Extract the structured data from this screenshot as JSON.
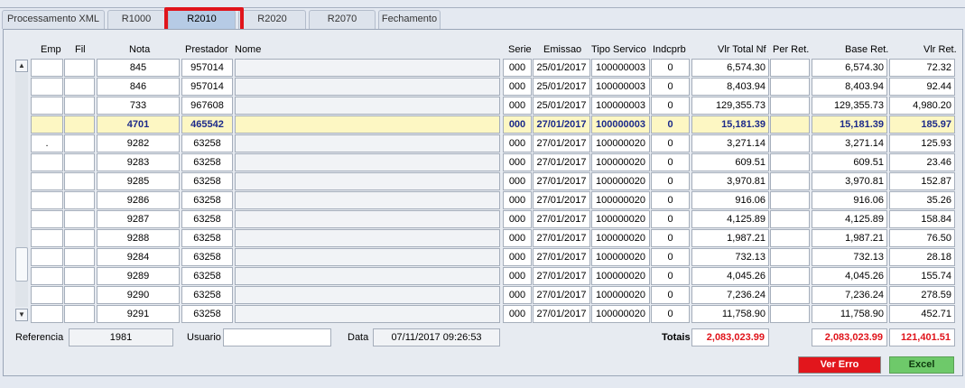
{
  "tabs": [
    {
      "label": "Processamento XML",
      "active": false
    },
    {
      "label": "R1000",
      "active": false
    },
    {
      "label": "R2010",
      "active": true
    },
    {
      "label": "R2020",
      "active": false
    },
    {
      "label": "R2070",
      "active": false
    },
    {
      "label": "Fechamento",
      "active": false
    }
  ],
  "columns": {
    "emp": "Emp",
    "fil": "Fil",
    "nota": "Nota",
    "prestador": "Prestador",
    "nome": "Nome",
    "serie": "Serie",
    "emissao": "Emissao",
    "tipo_servico": "Tipo Servico",
    "indcprb": "Indcprb",
    "vlr_total_nf": "Vlr Total Nf",
    "per_ret": "Per Ret.",
    "base_ret": "Base Ret.",
    "vlr_ret": "Vlr Ret."
  },
  "rows": [
    {
      "emp": "",
      "nota": "845",
      "prestador": "957014",
      "serie": "000",
      "emissao": "25/01/2017",
      "tipo_servico": "100000003",
      "indcprb": "0",
      "vlr_total_nf": "6,574.30",
      "base_ret": "6,574.30",
      "vlr_ret": "72.32"
    },
    {
      "emp": "",
      "nota": "846",
      "prestador": "957014",
      "serie": "000",
      "emissao": "25/01/2017",
      "tipo_servico": "100000003",
      "indcprb": "0",
      "vlr_total_nf": "8,403.94",
      "base_ret": "8,403.94",
      "vlr_ret": "92.44"
    },
    {
      "emp": "",
      "nota": "733",
      "prestador": "967608",
      "serie": "000",
      "emissao": "25/01/2017",
      "tipo_servico": "100000003",
      "indcprb": "0",
      "vlr_total_nf": "129,355.73",
      "base_ret": "129,355.73",
      "vlr_ret": "4,980.20"
    },
    {
      "emp": "",
      "nota": "4701",
      "prestador": "465542",
      "serie": "000",
      "emissao": "27/01/2017",
      "tipo_servico": "100000003",
      "indcprb": "0",
      "vlr_total_nf": "15,181.39",
      "base_ret": "15,181.39",
      "vlr_ret": "185.97",
      "selected": true
    },
    {
      "emp": ".",
      "nota": "9282",
      "prestador": "63258",
      "serie": "000",
      "emissao": "27/01/2017",
      "tipo_servico": "100000020",
      "indcprb": "0",
      "vlr_total_nf": "3,271.14",
      "base_ret": "3,271.14",
      "vlr_ret": "125.93"
    },
    {
      "emp": "",
      "nota": "9283",
      "prestador": "63258",
      "serie": "000",
      "emissao": "27/01/2017",
      "tipo_servico": "100000020",
      "indcprb": "0",
      "vlr_total_nf": "609.51",
      "base_ret": "609.51",
      "vlr_ret": "23.46"
    },
    {
      "emp": "",
      "nota": "9285",
      "prestador": "63258",
      "serie": "000",
      "emissao": "27/01/2017",
      "tipo_servico": "100000020",
      "indcprb": "0",
      "vlr_total_nf": "3,970.81",
      "base_ret": "3,970.81",
      "vlr_ret": "152.87"
    },
    {
      "emp": "",
      "nota": "9286",
      "prestador": "63258",
      "serie": "000",
      "emissao": "27/01/2017",
      "tipo_servico": "100000020",
      "indcprb": "0",
      "vlr_total_nf": "916.06",
      "base_ret": "916.06",
      "vlr_ret": "35.26"
    },
    {
      "emp": "",
      "nota": "9287",
      "prestador": "63258",
      "serie": "000",
      "emissao": "27/01/2017",
      "tipo_servico": "100000020",
      "indcprb": "0",
      "vlr_total_nf": "4,125.89",
      "base_ret": "4,125.89",
      "vlr_ret": "158.84"
    },
    {
      "emp": "",
      "nota": "9288",
      "prestador": "63258",
      "serie": "000",
      "emissao": "27/01/2017",
      "tipo_servico": "100000020",
      "indcprb": "0",
      "vlr_total_nf": "1,987.21",
      "base_ret": "1,987.21",
      "vlr_ret": "76.50"
    },
    {
      "emp": "",
      "nota": "9284",
      "prestador": "63258",
      "serie": "000",
      "emissao": "27/01/2017",
      "tipo_servico": "100000020",
      "indcprb": "0",
      "vlr_total_nf": "732.13",
      "base_ret": "732.13",
      "vlr_ret": "28.18"
    },
    {
      "emp": "",
      "nota": "9289",
      "prestador": "63258",
      "serie": "000",
      "emissao": "27/01/2017",
      "tipo_servico": "100000020",
      "indcprb": "0",
      "vlr_total_nf": "4,045.26",
      "base_ret": "4,045.26",
      "vlr_ret": "155.74"
    },
    {
      "emp": "",
      "nota": "9290",
      "prestador": "63258",
      "serie": "000",
      "emissao": "27/01/2017",
      "tipo_servico": "100000020",
      "indcprb": "0",
      "vlr_total_nf": "7,236.24",
      "base_ret": "7,236.24",
      "vlr_ret": "278.59"
    },
    {
      "emp": "",
      "nota": "9291",
      "prestador": "63258",
      "serie": "000",
      "emissao": "27/01/2017",
      "tipo_servico": "100000020",
      "indcprb": "0",
      "vlr_total_nf": "11,758.90",
      "base_ret": "11,758.90",
      "vlr_ret": "452.71"
    }
  ],
  "footer": {
    "referencia_label": "Referencia",
    "referencia_value": "1981",
    "usuario_label": "Usuario",
    "usuario_value": "",
    "data_label": "Data",
    "data_value": "07/11/2017 09:26:53",
    "totais_label": "Totais",
    "total_vlr_nf": "2,083,023.99",
    "total_base_ret": "2,083,023.99",
    "total_vlr_ret": "121,401.51"
  },
  "buttons": {
    "ver_erro": "Ver Erro",
    "excel": "Excel"
  },
  "colors": {
    "highlight_border": "#e0141b",
    "selected_row": "#fdf7c3",
    "totals_text": "#e0141b",
    "error_button": "#e2161c",
    "excel_button": "#6ec96a"
  },
  "icons": {
    "scroll_up": "triangle-up",
    "scroll_down": "triangle-down"
  }
}
